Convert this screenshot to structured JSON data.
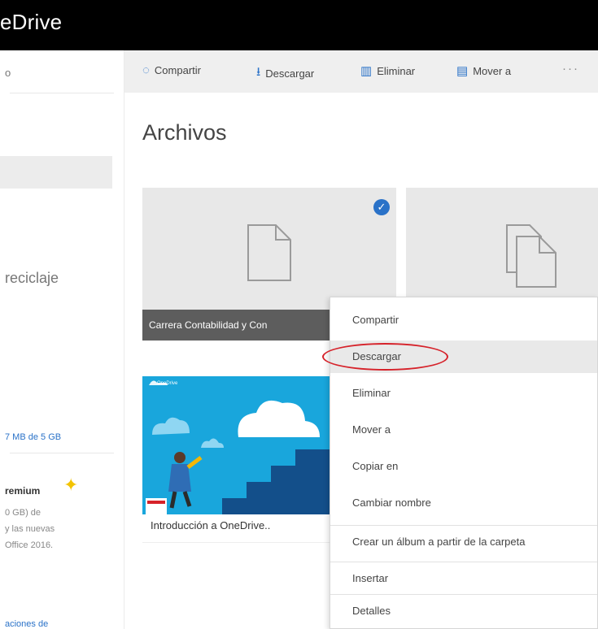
{
  "app": {
    "brand": "eDrive"
  },
  "sidebar": {
    "search_stub": "o",
    "recycle_bin": "reciclaje",
    "storage_text": "7 MB de 5 GB",
    "premium_title": "remium",
    "premium_lines": [
      "0 GB) de",
      "y las nuevas",
      "Office 2016."
    ],
    "more_link": "aciones de"
  },
  "toolbar": {
    "share": "Compartir",
    "download": "Descargar",
    "delete": "Eliminar",
    "move": "Mover a",
    "more": "···"
  },
  "main": {
    "title": "Archivos",
    "files": [
      {
        "name": "Carrera Contabilidad y Con",
        "count": "1",
        "selected": true
      },
      {
        "name": "",
        "count": "",
        "selected": false
      },
      {
        "name": "Introducción a OneDrive..",
        "thumb_brand": "OneDrive"
      }
    ]
  },
  "context_menu": {
    "items": [
      {
        "label": "Compartir"
      },
      {
        "label": "Descargar",
        "hover": true,
        "circled": true
      },
      {
        "label": "Eliminar"
      },
      {
        "label": "Mover a"
      },
      {
        "label": "Copiar en"
      },
      {
        "label": "Cambiar nombre"
      },
      {
        "label": "Crear un álbum a partir de la carpeta"
      },
      {
        "label": "Insertar"
      },
      {
        "label": "Detalles"
      }
    ]
  },
  "colors": {
    "accent": "#2a72c8",
    "highlight_ring": "#d6222a",
    "thumbnail_bg": "#19a6dc"
  }
}
